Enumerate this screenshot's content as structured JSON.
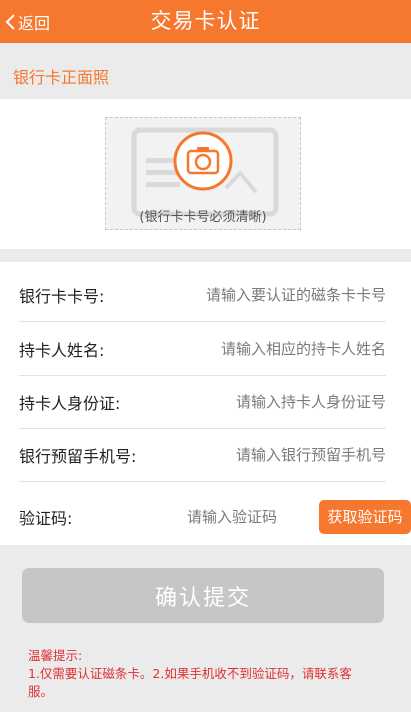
{
  "header": {
    "back_label": "返回",
    "title": "交易卡认证",
    "color": "#f6772e"
  },
  "photo": {
    "section_label": "银行卡正面照",
    "hint": "(银行卡卡号必须清晰)",
    "icon": "camera-icon"
  },
  "form": {
    "card_number": {
      "label": "银行卡卡号:",
      "placeholder": "请输入要认证的磁条卡卡号"
    },
    "holder_name": {
      "label": "持卡人姓名:",
      "placeholder": "请输入相应的持卡人姓名"
    },
    "holder_id": {
      "label": "持卡人身份证:",
      "placeholder": "请输入持卡人身份证号"
    },
    "phone": {
      "label": "银行预留手机号:",
      "placeholder": "请输入银行预留手机号"
    },
    "code": {
      "label": "验证码:",
      "placeholder": "请输入验证码",
      "button": "获取验证码"
    }
  },
  "submit_label": "确认提交",
  "tips": {
    "title": "温馨提示:",
    "text": "1.仅需要认证磁条卡。2.如果手机收不到验证码，请联系客服。"
  }
}
